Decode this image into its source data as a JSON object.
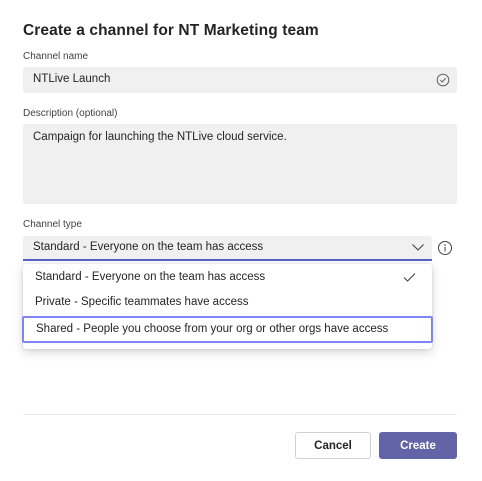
{
  "dialog": {
    "title": "Create a channel for NT Marketing team",
    "channel_name": {
      "label": "Channel name",
      "value": "NTLive Launch",
      "icon": "check-circle-icon"
    },
    "description": {
      "label": "Description (optional)",
      "value": "Campaign for launching the NTLive cloud service."
    },
    "channel_type": {
      "label": "Channel type",
      "selected": "Standard - Everyone on the team has access",
      "icon": "chevron-down-icon",
      "info_icon": "info-icon",
      "options": [
        {
          "label": "Standard - Everyone on the team has access",
          "checked": true
        },
        {
          "label": "Private - Specific teammates have access",
          "checked": false
        },
        {
          "label": "Shared - People you choose from your org or other orgs have access",
          "checked": false,
          "focused": true
        }
      ]
    },
    "buttons": {
      "cancel": "Cancel",
      "create": "Create"
    },
    "colors": {
      "accent": "#5b5fc7",
      "primary_button": "#6264a7",
      "focus_outline": "#7f85f5",
      "field_background": "#f0f0f0"
    }
  }
}
